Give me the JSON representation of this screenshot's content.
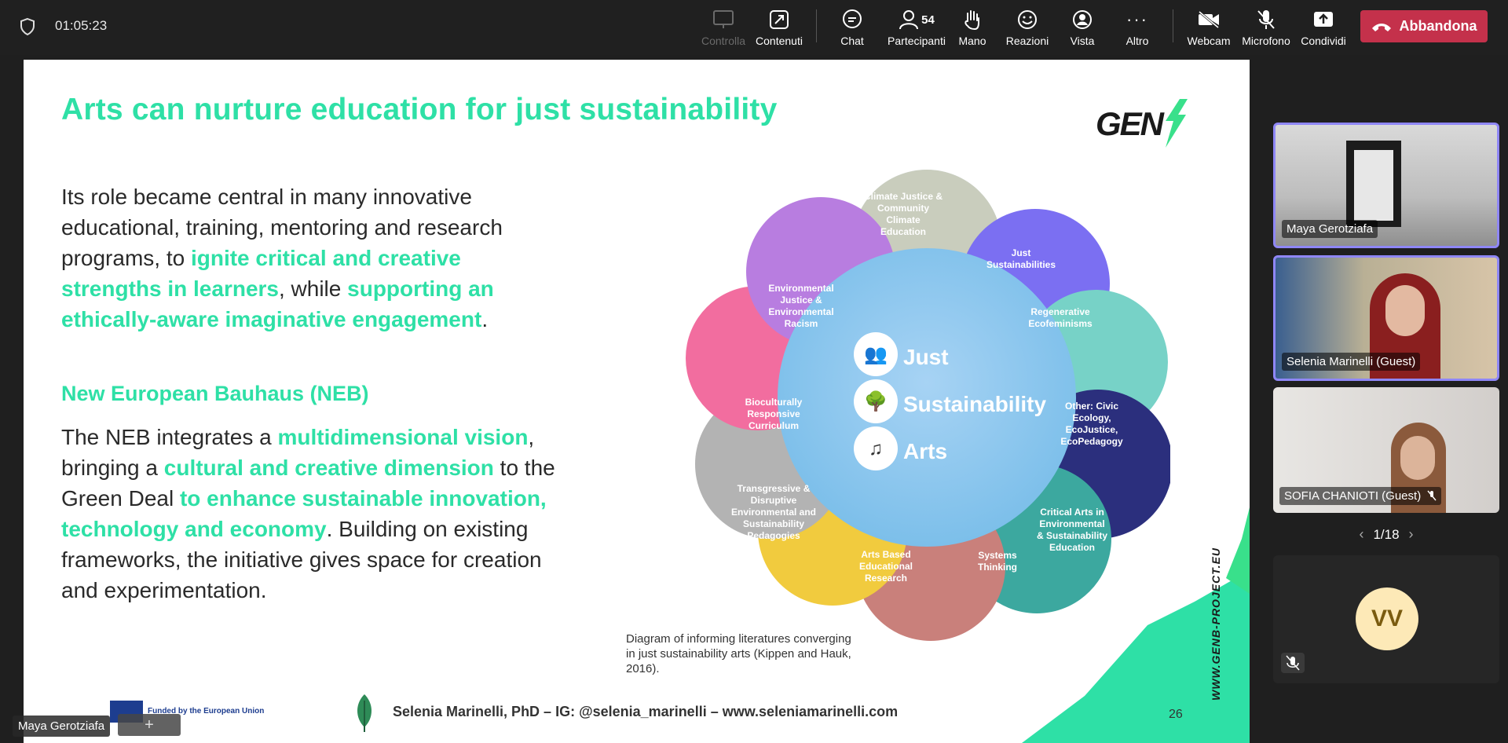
{
  "topbar": {
    "timer": "01:05:23",
    "buttons": [
      {
        "id": "controlla",
        "label": "Controlla",
        "icon": "control-icon"
      },
      {
        "id": "contenuti",
        "label": "Contenuti",
        "icon": "share-content-icon"
      },
      {
        "id": "chat",
        "label": "Chat",
        "icon": "chat-icon"
      },
      {
        "id": "partecipanti",
        "label": "Partecipanti",
        "icon": "people-icon",
        "badge": "54"
      },
      {
        "id": "mano",
        "label": "Mano",
        "icon": "raise-hand-icon"
      },
      {
        "id": "reazioni",
        "label": "Reazioni",
        "icon": "smiley-icon"
      },
      {
        "id": "vista",
        "label": "Vista",
        "icon": "view-icon"
      },
      {
        "id": "altro",
        "label": "Altro",
        "icon": "more-icon"
      },
      {
        "id": "webcam",
        "label": "Webcam",
        "icon": "camera-off-icon"
      },
      {
        "id": "microfono",
        "label": "Microfono",
        "icon": "mic-off-icon"
      },
      {
        "id": "condividi",
        "label": "Condividi",
        "icon": "share-icon"
      }
    ],
    "leave_label": "Abbandona",
    "leave_color": "#c4314b"
  },
  "slide": {
    "title": "Arts can nurture education for just sustainability",
    "logo": "GEN",
    "p1": {
      "a": "Its role became central in many innovative educational, training, mentoring and research programs, to ",
      "h1": "ignite critical and creative strengths in learners",
      "b": ", while ",
      "h2": "supporting an ethically-aware imaginative engagement",
      "c": "."
    },
    "neb_heading": "New European Bauhaus  (NEB)",
    "p2": {
      "a": "The NEB integrates a ",
      "h1": "multidimensional vision",
      "b": ", bringing a ",
      "h2": "cultural and creative dimension",
      "c": " to the Green Deal ",
      "h3": "to enhance sustainable innovation, technology and economy",
      "d": ". Building on existing frameworks, the initiative gives space for creation and experimentation."
    },
    "diagram": {
      "center": [
        "Just",
        "Sustainability",
        "Arts"
      ],
      "petals": [
        "Climate Justice & Community Climate Education",
        "Just Sustainabilities",
        "Regenerative Ecofeminisms",
        "Other: Civic Ecology, EcoJustice, EcoPedagogy",
        "Critical Arts in Environmental & Sustainability Education",
        "Systems Thinking",
        "Arts Based Educational Research",
        "Transgressive & Disruptive Environmental and Sustainability Pedagogies",
        "Bioculturally Responsive Curriculum",
        "Environmental Justice & Environmental Racism"
      ]
    },
    "caption": "Diagram of informing literatures converging in just sustainability arts (Kippen and Hauk, 2016).",
    "footer": "Selenia Marinelli, PhD – IG: @selenia_marinelli – www.seleniamarinelli.com",
    "page_number": "26",
    "website": "WWW.GENB-PROJECT.EU",
    "eu_text": "Funded by the European Union",
    "accent": "#2ee0a6"
  },
  "stage": {
    "speaker": "Maya Gerotziafa"
  },
  "participants": [
    {
      "name": "Maya Gerotziafa",
      "active": true
    },
    {
      "name": "Selenia Marinelli (Guest)",
      "active": true
    },
    {
      "name": "SOFIA CHANIOTI (Guest)",
      "active": false,
      "muted": true
    }
  ],
  "pager": "1/18",
  "guest_initials": "VV"
}
